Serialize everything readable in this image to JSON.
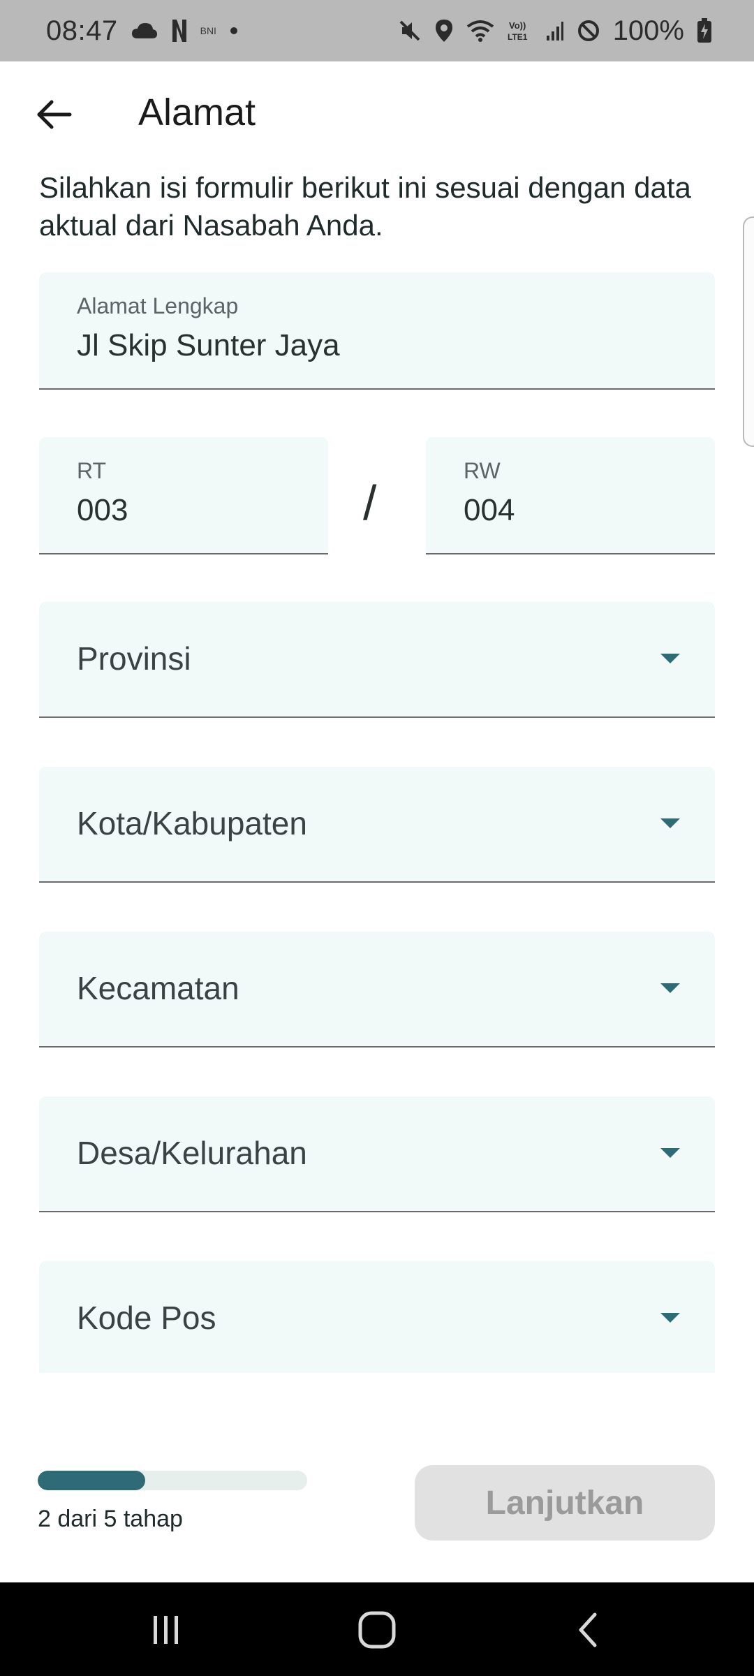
{
  "status_bar": {
    "time": "08:47",
    "small_label": "BNI",
    "battery_text": "100%",
    "icons": [
      "cloud-icon",
      "netflix-icon",
      "bni-icon",
      "dot-icon",
      "mute-icon",
      "location-icon",
      "wifi-icon",
      "volte-icon",
      "signal-icon",
      "dnd-icon",
      "battery-charging-icon"
    ],
    "volte_label": "Vo))\nLTE1"
  },
  "app_bar": {
    "back_icon": "arrow-left-icon",
    "title": "Alamat"
  },
  "intro_text": "Silahkan isi formulir berikut ini sesuai dengan data aktual dari Nasabah Anda.",
  "form": {
    "address": {
      "label": "Alamat Lengkap",
      "value": "Jl Skip Sunter Jaya"
    },
    "rt": {
      "label": "RT",
      "value": "003"
    },
    "separator": "/",
    "rw": {
      "label": "RW",
      "value": "004"
    },
    "selects": [
      {
        "label": "Provinsi",
        "icon": "caret-down-icon"
      },
      {
        "label": "Kota/Kabupaten",
        "icon": "caret-down-icon"
      },
      {
        "label": "Kecamatan",
        "icon": "caret-down-icon"
      },
      {
        "label": "Desa/Kelurahan",
        "icon": "caret-down-icon"
      },
      {
        "label": "Kode Pos",
        "icon": "caret-down-icon"
      }
    ]
  },
  "footer": {
    "progress_fraction": 0.4,
    "progress_text": "2 dari 5 tahap",
    "next_label": "Lanjutkan"
  },
  "colors": {
    "accent": "#2e6b77",
    "field_bg": "#f1faf8",
    "button_disabled_bg": "#e1e1e1",
    "button_disabled_text": "#9a9a9a"
  },
  "nav_bar": {
    "icons": [
      "recent-apps-icon",
      "home-icon",
      "back-nav-icon"
    ]
  }
}
